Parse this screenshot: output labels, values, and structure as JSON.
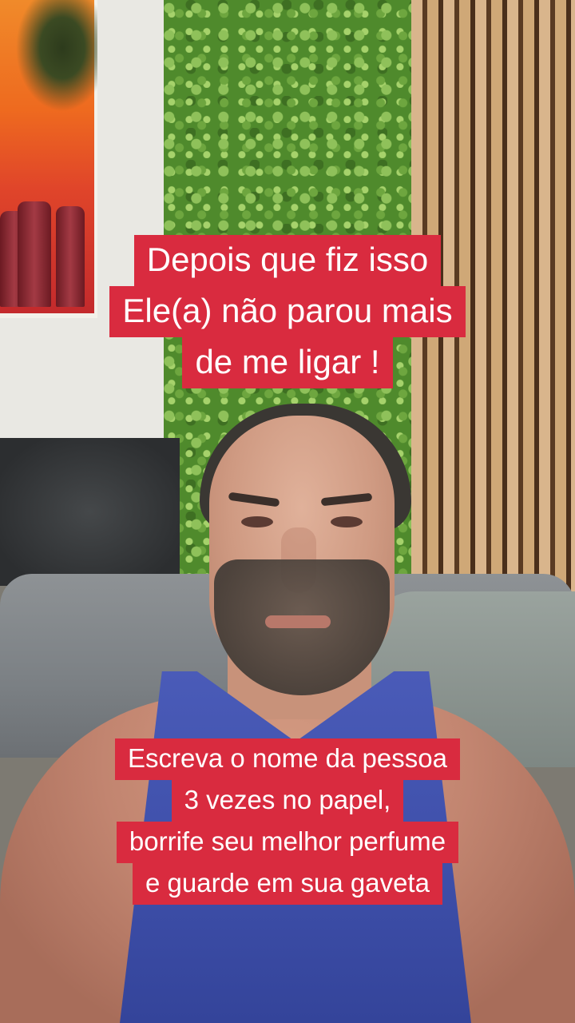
{
  "captions": {
    "top": [
      "Depois que fiz isso",
      "Ele(a) não parou mais",
      "de me ligar !"
    ],
    "bottom": [
      "Escreva o nome da pessoa",
      "3 vezes no papel,",
      "borrife seu melhor perfume",
      "e guarde em sua gaveta"
    ]
  },
  "colors": {
    "caption_background": "#d92b3f",
    "caption_text": "#ffffff"
  }
}
